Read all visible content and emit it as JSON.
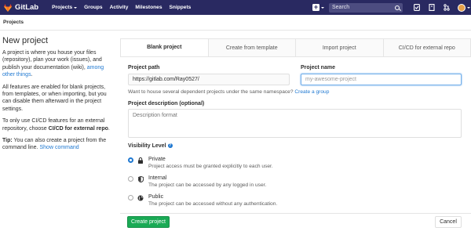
{
  "navbar": {
    "logo_text": "GitLab",
    "links": [
      {
        "label": "Projects",
        "dropdown": true
      },
      {
        "label": "Groups",
        "dropdown": false
      },
      {
        "label": "Activity",
        "dropdown": false
      },
      {
        "label": "Milestones",
        "dropdown": false
      },
      {
        "label": "Snippets",
        "dropdown": false
      }
    ],
    "search_placeholder": "Search",
    "bg_color": "#292961"
  },
  "breadcrumb": {
    "label": "Projects"
  },
  "sidebar": {
    "title": "New project",
    "p1_text": "A project is where you house your files (repository), plan your work (issues), and publish your documentation (wiki),",
    "p1_link": "among other things",
    "p1_end": ".",
    "p2_text": "All features are enabled for blank projects, from templates, or when importing, but you can disable them afterward in the project settings.",
    "p3_text": "To only use CI/CD features for an external repository, choose",
    "p3_bold": "CI/CD for external repo",
    "p3_end": ".",
    "tip_label": "Tip:",
    "tip_text": "You can also create a project from the command line.",
    "tip_link": "Show command"
  },
  "tabs": [
    {
      "label": "Blank project",
      "active": true
    },
    {
      "label": "Create from template",
      "active": false
    },
    {
      "label": "Import project",
      "active": false
    },
    {
      "label": "CI/CD for external repo",
      "active": false
    }
  ],
  "form": {
    "path_label": "Project path",
    "path_value": "https://gitlab.com/Ray0527/",
    "name_label": "Project name",
    "name_placeholder": "my-awesome-project",
    "namespace_help": "Want to house several dependent projects under the same namespace?",
    "namespace_link": "Create a group",
    "desc_label": "Project description (optional)",
    "desc_placeholder": "Description format",
    "visibility_label": "Visibility Level",
    "visibility": [
      {
        "title": "Private",
        "desc": "Project access must be granted explicitly to each user.",
        "selected": true,
        "icon": "lock-icon"
      },
      {
        "title": "Internal",
        "desc": "The project can be accessed by any logged in user.",
        "selected": false,
        "icon": "shield-icon"
      },
      {
        "title": "Public",
        "desc": "The project can be accessed without any authentication.",
        "selected": false,
        "icon": "globe-icon"
      }
    ],
    "create_label": "Create project",
    "cancel_label": "Cancel"
  },
  "colors": {
    "accent": "#1f78d1",
    "success": "#1aaa55"
  }
}
